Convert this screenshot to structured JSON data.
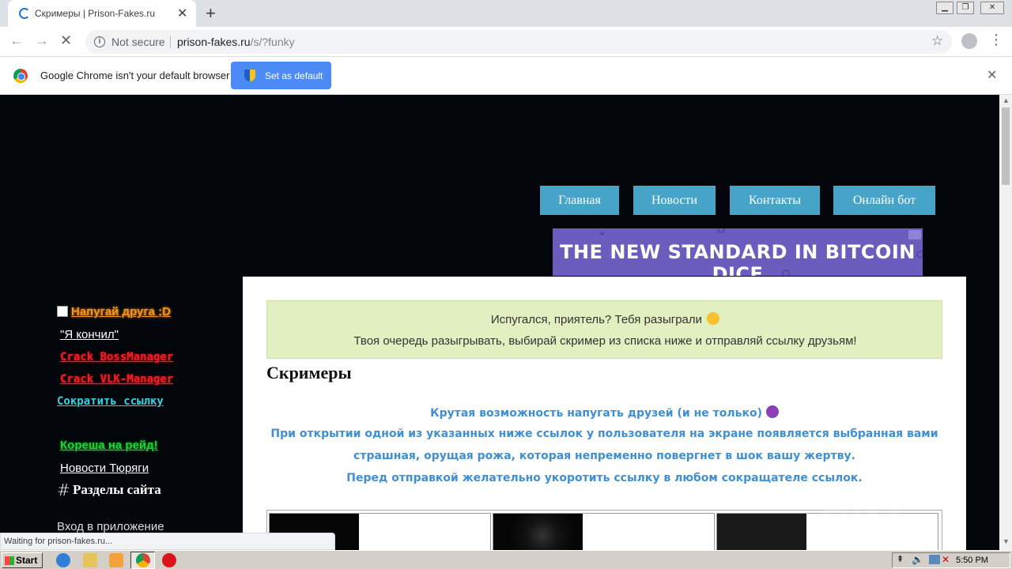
{
  "browser": {
    "tab": {
      "title": "Скримеры | Prison-Fakes.ru"
    },
    "address": {
      "security": "Not secure",
      "host": "prison-fakes.ru",
      "path": "/s/?funky"
    },
    "infobar": {
      "message": "Google Chrome isn't your default browser",
      "button": "Set as default"
    },
    "status": "Waiting for prison-fakes.ru..."
  },
  "page": {
    "nav": [
      "Главная",
      "Новости",
      "Контакты",
      "Онлайн бот"
    ],
    "banner": {
      "text": "THE NEW STANDARD IN BITCOIN DICE"
    },
    "sidebar": {
      "links": [
        "Напугай друга ;D",
        "\"Я кончил\"",
        "Crack BossManager",
        "Crack VLK-Manager",
        "Сократить ссылку",
        "Кореша на рейд!",
        "Новости Тюряги"
      ],
      "sections_title": "Разделы сайта",
      "login": "Вход в приложение"
    },
    "alert": {
      "line1": "Испугался, приятель? Тебя разыграли",
      "line2": "Твоя очередь разыгрывать, выбирай скример из списка ниже и отправляй ссылку друзьям!"
    },
    "heading": "Скримеры",
    "description": [
      "Крутая возможность напугать друзей (и не только)",
      "При открытии одной из указанных ниже ссылок у пользователя на экране появляется выбранная вами",
      "страшная, орущая рожа, которая непременно повергнет в шок вашу жертву.",
      "Перед отправкой желательно укоротить ссылку в любом сокращателе ссылок."
    ]
  },
  "watermark": "ANY RUN",
  "taskbar": {
    "start": "Start",
    "clock": "5:50 PM"
  }
}
